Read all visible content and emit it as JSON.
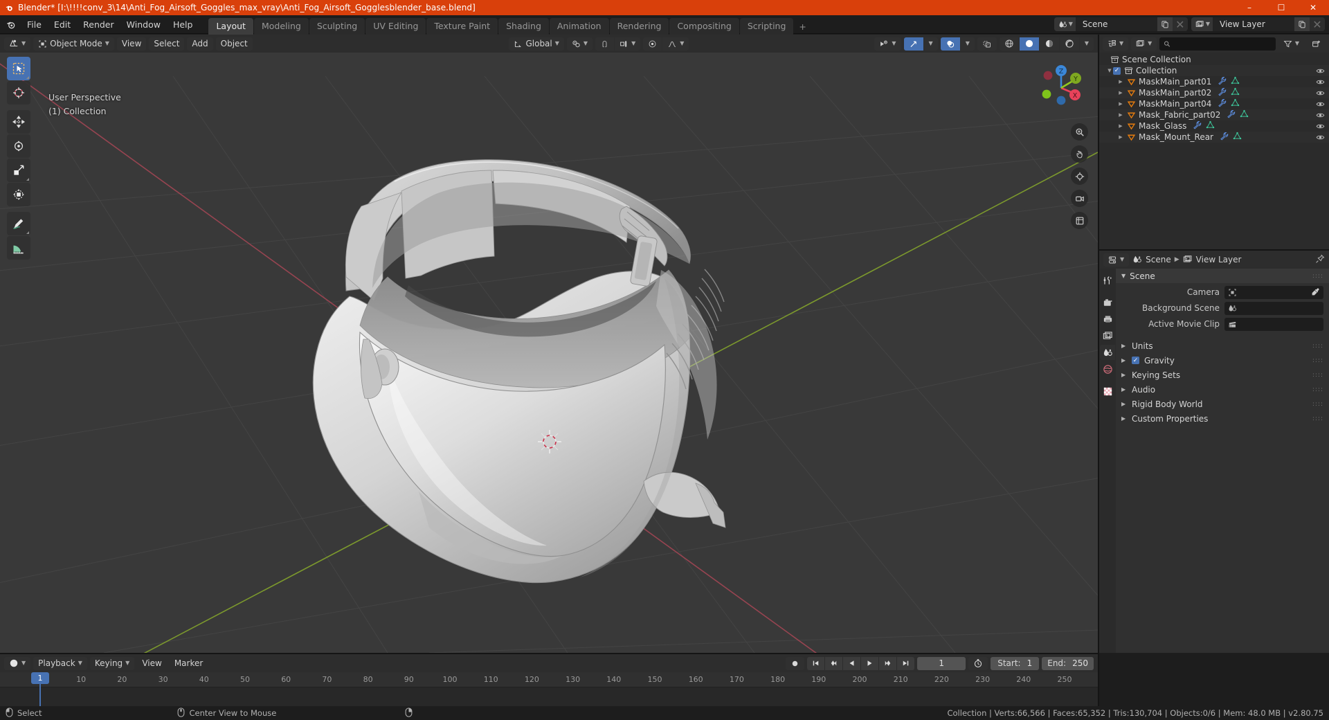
{
  "window": {
    "title": "Blender* [I:\\!!!!conv_3\\14\\Anti_Fog_Airsoft_Goggles_max_vray\\Anti_Fog_Airsoft_Gogglesblender_base.blend]",
    "minimize": "–",
    "maximize": "☐",
    "close": "✕"
  },
  "menu": {
    "items": [
      "File",
      "Edit",
      "Render",
      "Window",
      "Help"
    ]
  },
  "workspaces": {
    "tabs": [
      "Layout",
      "Modeling",
      "Sculpting",
      "UV Editing",
      "Texture Paint",
      "Shading",
      "Animation",
      "Rendering",
      "Compositing",
      "Scripting"
    ],
    "active": "Layout",
    "add_label": "+"
  },
  "topbar_right": {
    "scene_name": "Scene",
    "view_layer_name": "View Layer"
  },
  "viewport": {
    "header": {
      "editor_type": "editor-type-3dview",
      "mode": "Object Mode",
      "menus": [
        "View",
        "Select",
        "Add",
        "Object"
      ],
      "transform_orientation": "Global",
      "snap_enabled": false,
      "proportional_editing": false
    },
    "overlay_text": {
      "perspective": "User Perspective",
      "collection": "(1) Collection"
    },
    "gizmo_axes": {
      "x": "X",
      "y": "Y",
      "z": "Z"
    },
    "tools": [
      "select-box-tool",
      "cursor-tool",
      "move-tool",
      "rotate-tool",
      "scale-tool",
      "transform-tool",
      "annotate-tool",
      "measure-tool"
    ],
    "shading_modes": [
      "wireframe",
      "solid",
      "material-preview",
      "rendered"
    ],
    "active_shading": "solid"
  },
  "outliner": {
    "search_placeholder": "",
    "rows": [
      {
        "label": "Scene Collection",
        "indent": 0,
        "type": "scene-collection",
        "disclosure": "",
        "checkbox": false,
        "icons": [],
        "eye": false
      },
      {
        "label": "Collection",
        "indent": 1,
        "type": "collection",
        "disclosure": "▼",
        "checkbox": true,
        "icons": [],
        "eye": true
      },
      {
        "label": "MaskMain_part01",
        "indent": 2,
        "type": "mesh-object",
        "disclosure": "▶",
        "checkbox": false,
        "icons": [
          "modifier-wrench",
          "mesh-data"
        ],
        "eye": true
      },
      {
        "label": "MaskMain_part02",
        "indent": 2,
        "type": "mesh-object",
        "disclosure": "▶",
        "checkbox": false,
        "icons": [
          "modifier-wrench",
          "mesh-data"
        ],
        "eye": true
      },
      {
        "label": "MaskMain_part04",
        "indent": 2,
        "type": "mesh-object",
        "disclosure": "▶",
        "checkbox": false,
        "icons": [
          "modifier-wrench",
          "mesh-data"
        ],
        "eye": true
      },
      {
        "label": "Mask_Fabric_part02",
        "indent": 2,
        "type": "mesh-object",
        "disclosure": "▶",
        "checkbox": false,
        "icons": [
          "modifier-wrench",
          "mesh-data"
        ],
        "eye": true
      },
      {
        "label": "Mask_Glass",
        "indent": 2,
        "type": "mesh-object",
        "disclosure": "▶",
        "checkbox": false,
        "icons": [
          "modifier-wrench",
          "mesh-data"
        ],
        "eye": true
      },
      {
        "label": "Mask_Mount_Rear",
        "indent": 2,
        "type": "mesh-object",
        "disclosure": "▶",
        "checkbox": false,
        "icons": [
          "modifier-wrench",
          "mesh-data"
        ],
        "eye": true
      }
    ]
  },
  "properties": {
    "breadcrumb": {
      "scene": "Scene",
      "view_layer": "View Layer"
    },
    "panel_title": "Scene",
    "tabs": [
      "tool",
      "render",
      "output",
      "view-layer",
      "scene",
      "world",
      "texture"
    ],
    "active_tab": "scene",
    "fields": [
      {
        "label": "Camera",
        "value": "",
        "icon": "camera-icon",
        "eyedropper": true
      },
      {
        "label": "Background Scene",
        "value": "",
        "icon": "scene-icon",
        "eyedropper": false
      },
      {
        "label": "Active Movie Clip",
        "value": "",
        "icon": "clip-icon",
        "eyedropper": false
      }
    ],
    "sections": [
      {
        "label": "Units",
        "checkbox": null
      },
      {
        "label": "Gravity",
        "checkbox": true
      },
      {
        "label": "Keying Sets",
        "checkbox": null
      },
      {
        "label": "Audio",
        "checkbox": null
      },
      {
        "label": "Rigid Body World",
        "checkbox": null
      },
      {
        "label": "Custom Properties",
        "checkbox": null
      }
    ]
  },
  "timeline": {
    "menus": [
      "Playback",
      "Keying",
      "View",
      "Marker"
    ],
    "current_frame": "1",
    "start_label": "Start:",
    "start_value": "1",
    "end_label": "End:",
    "end_value": "250",
    "ticks": [
      "10",
      "20",
      "30",
      "40",
      "50",
      "60",
      "70",
      "80",
      "90",
      "100",
      "110",
      "120",
      "130",
      "140",
      "150",
      "160",
      "170",
      "180",
      "190",
      "200",
      "210",
      "220",
      "230",
      "240",
      "250"
    ],
    "playhead_label": "1",
    "transport": [
      "jump-start",
      "prev-keyframe",
      "play-reverse",
      "play",
      "next-keyframe",
      "jump-end"
    ],
    "record_button": "record-icon"
  },
  "statusbar": {
    "left_action": "Select",
    "middle_action": "Center View to Mouse",
    "stats": "Collection | Verts:66,566 | Faces:65,352 | Tris:130,704 | Objects:0/6 | Mem: 48.0 MB | v2.80.75"
  },
  "colors": {
    "accent_blue": "#4772b3",
    "title_orange": "#d9400b",
    "viewport_bg": "#393939",
    "object_orange": "#e87d0d",
    "mesh_green": "#3ec59a",
    "wrench_blue": "#5d8ee0",
    "axis_x": "#e8425a",
    "axis_y": "#93c81f",
    "axis_z": "#3b87d8"
  }
}
